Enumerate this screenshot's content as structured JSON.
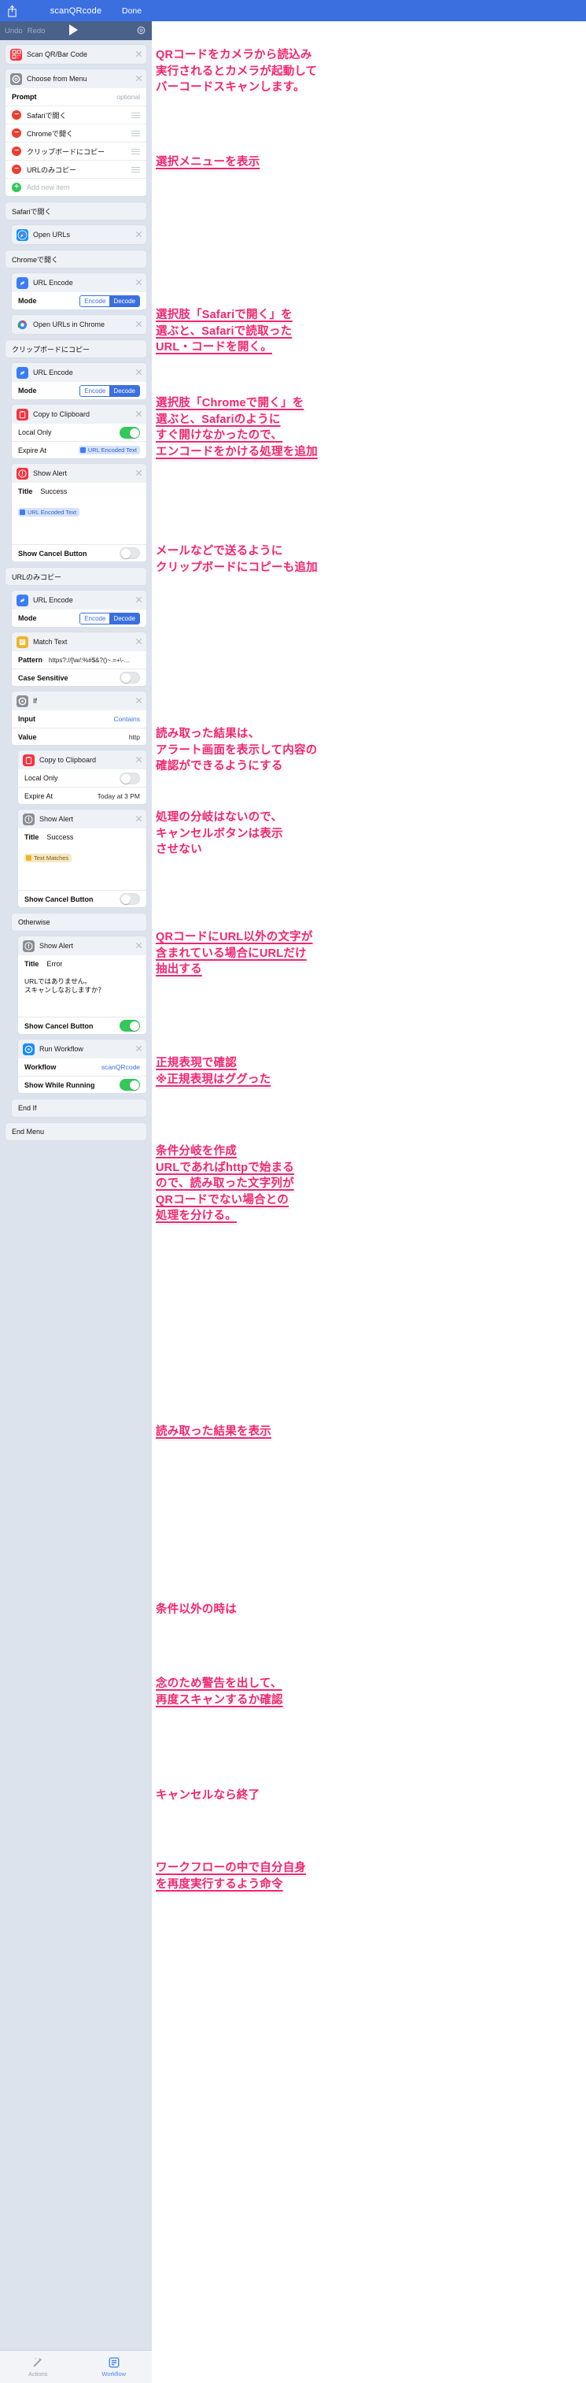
{
  "nav": {
    "share_icon": "share-icon",
    "title": "scanQRcode",
    "done": "Done"
  },
  "toolbar": {
    "undo": "Undo",
    "redo": "Redo",
    "play_icon": "play-icon",
    "settings_icon": "gear-icon"
  },
  "actions": {
    "scan": {
      "title": "Scan QR/Bar Code",
      "icon": "qr-code-icon"
    },
    "choose_menu": {
      "title": "Choose from Menu",
      "icon": "gear-icon",
      "prompt_label": "Prompt",
      "prompt_optional": "optional",
      "items": [
        "Safariで開く",
        "Chromeで開く",
        "クリップボードにコピー",
        "URLのみコピー"
      ],
      "add_new": "Add new item"
    },
    "section_safari": "Safariで開く",
    "open_urls": {
      "title": "Open URLs",
      "icon": "safari-icon"
    },
    "section_chrome": "Chromeで開く",
    "url_encode_1": {
      "title": "URL Encode",
      "icon": "link-icon",
      "mode_label": "Mode",
      "mode_options": [
        "Encode",
        "Decode"
      ],
      "mode_selected": "Decode"
    },
    "open_urls_chrome": {
      "title": "Open URLs in Chrome",
      "icon": "chrome-icon"
    },
    "section_clipboard": "クリップボードにコピー",
    "url_encode_2": {
      "title": "URL Encode",
      "icon": "link-icon",
      "mode_label": "Mode",
      "mode_options": [
        "Encode",
        "Decode"
      ],
      "mode_selected": "Decode"
    },
    "copy_clipboard_1": {
      "title": "Copy to Clipboard",
      "icon": "clipboard-icon",
      "local_only_label": "Local Only",
      "local_only_on": true,
      "expire_label": "Expire At",
      "expire_chip": "URL Encoded Text"
    },
    "show_alert_1": {
      "title": "Show Alert",
      "icon": "alert-icon",
      "title_label": "Title",
      "title_value": "Success",
      "body_chip": "URL Encoded Text",
      "cancel_label": "Show Cancel Button",
      "cancel_on": false
    },
    "section_url_only": "URLのみコピー",
    "url_encode_3": {
      "title": "URL Encode",
      "icon": "link-icon",
      "mode_label": "Mode",
      "mode_options": [
        "Encode",
        "Decode"
      ],
      "mode_selected": "Decode"
    },
    "match_text": {
      "title": "Match Text",
      "icon": "match-text-icon",
      "pattern_label": "Pattern",
      "pattern_value": "https?://[\\w/:%#$&?()~.=+\\-…",
      "case_label": "Case Sensitive",
      "case_on": false
    },
    "if_action": {
      "title": "If",
      "icon": "if-icon",
      "input_label": "Input",
      "input_value": "Contains",
      "value_label": "Value",
      "value_value": "http"
    },
    "copy_clipboard_2": {
      "title": "Copy to Clipboard",
      "icon": "clipboard-icon",
      "local_only_label": "Local Only",
      "local_only_on": false,
      "expire_label": "Expire At",
      "expire_value": "Today at 3 PM"
    },
    "show_alert_2": {
      "title": "Show Alert",
      "icon": "alert-icon",
      "title_label": "Title",
      "title_value": "Success",
      "body_chip": "Text Matches",
      "cancel_label": "Show Cancel Button",
      "cancel_on": false
    },
    "otherwise": "Otherwise",
    "show_alert_3": {
      "title": "Show Alert",
      "icon": "alert-icon",
      "title_label": "Title",
      "title_value": "Error",
      "message": "URLではありません。\nスキャンしなおしますか？",
      "cancel_label": "Show Cancel Button",
      "cancel_on": true
    },
    "run_workflow": {
      "title": "Run Workflow",
      "icon": "workflow-icon",
      "workflow_label": "Workflow",
      "workflow_value": "scanQRcode",
      "show_running_label": "Show While Running",
      "show_running_on": true
    },
    "end_if": "End If",
    "end_menu": "End Menu"
  },
  "tabbar": {
    "actions": "Actions",
    "workflow": "Workflow",
    "actions_icon": "magic-wand-icon",
    "workflow_icon": "workflow-icon"
  },
  "annotations": [
    {
      "id": "a1",
      "text": "QRコードをカメラから読込み\n実行されるとカメラが起動して\nバーコードスキャンします。",
      "underline": false
    },
    {
      "id": "a2",
      "text": "選択メニューを表示",
      "underline": true
    },
    {
      "id": "a3",
      "text": "選択肢「Safariで開く」を\n選ぶと、Safariで読取った\nURL・コードを開く。",
      "underline": true
    },
    {
      "id": "a4",
      "text": "選択肢「Chromeで開く」を\n選ぶと、Safariのように\nすぐ開けなかったので、\nエンコードをかける処理を追加",
      "underline": true
    },
    {
      "id": "a5",
      "text": "メールなどで送るように\nクリップボードにコピーも追加",
      "underline": false
    },
    {
      "id": "a6",
      "text": "読み取った結果は、\nアラート画面を表示して内容の\n確認ができるようにする",
      "underline": false
    },
    {
      "id": "a7",
      "text": "処理の分岐はないので、\nキャンセルボタンは表示\nさせない",
      "underline": false
    },
    {
      "id": "a8",
      "text": "QRコードにURL以外の文字が\n含まれている場合にURLだけ\n抽出する",
      "underline": true
    },
    {
      "id": "a9",
      "text": "正規表現で確認\n※正規表現はググった",
      "underline": true
    },
    {
      "id": "a10",
      "text": "条件分岐を作成\nURLであればhttpで始まる\nので、読み取った文字列が\nQRコードでない場合との\n処理を分ける。",
      "underline": true
    },
    {
      "id": "a11",
      "text": "読み取った結果を表示",
      "underline": true
    },
    {
      "id": "a12",
      "text": "条件以外の時は",
      "underline": false
    },
    {
      "id": "a13",
      "text": "念のため警告を出して、\n再度スキャンするか確認",
      "underline": true
    },
    {
      "id": "a14",
      "text": "キャンセルなら終了",
      "underline": false
    },
    {
      "id": "a15",
      "text": "ワークフローの中で自分自身\nを再度実行するよう命令",
      "underline": true
    }
  ]
}
